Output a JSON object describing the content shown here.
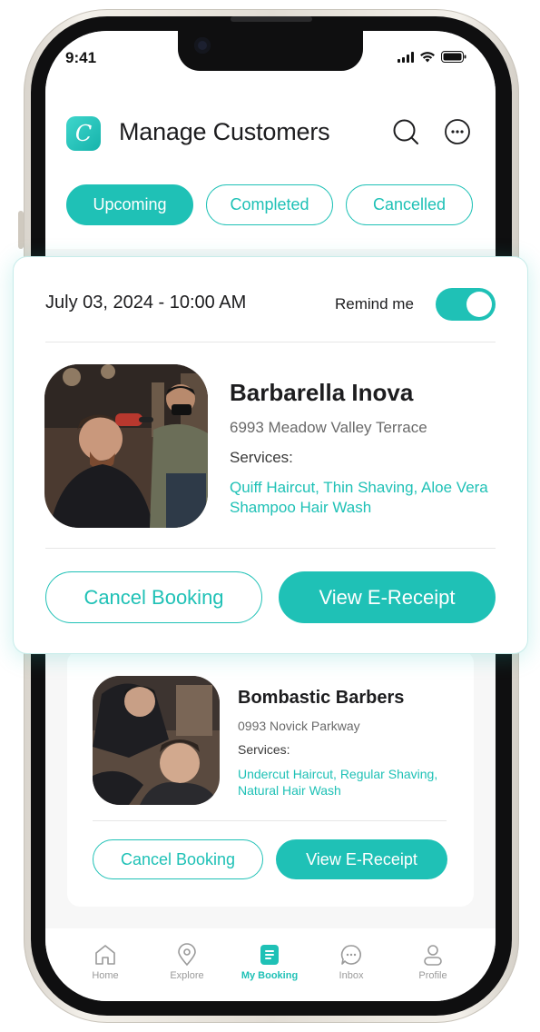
{
  "status": {
    "time": "9:41"
  },
  "header": {
    "title": "Manage Customers",
    "logo_letter": "C"
  },
  "tabs": [
    {
      "label": "Upcoming",
      "active": true
    },
    {
      "label": "Completed",
      "active": false
    },
    {
      "label": "Cancelled",
      "active": false
    }
  ],
  "booking_main": {
    "datetime": "July 03, 2024 - 10:00 AM",
    "remind_label": "Remind me",
    "remind_on": true,
    "shop_name": "Barbarella Inova",
    "address": "6993 Meadow Valley Terrace",
    "services_label": "Services:",
    "services": "Quiff Haircut, Thin Shaving, Aloe Vera Shampoo Hair Wash",
    "cancel_label": "Cancel Booking",
    "receipt_label": "View E-Receipt"
  },
  "booking_second": {
    "shop_name": "Bombastic Barbers",
    "address": "0993 Novick Parkway",
    "services_label": "Services:",
    "services": "Undercut Haircut, Regular Shaving, Natural Hair Wash",
    "cancel_label": "Cancel Booking",
    "receipt_label": "View E-Receipt"
  },
  "nav": [
    {
      "label": "Home",
      "icon": "home-icon"
    },
    {
      "label": "Explore",
      "icon": "location-pin-icon"
    },
    {
      "label": "My Booking",
      "icon": "booking-icon",
      "active": true
    },
    {
      "label": "Inbox",
      "icon": "chat-icon"
    },
    {
      "label": "Profile",
      "icon": "user-icon"
    }
  ],
  "colors": {
    "accent": "#1fc1b6",
    "text": "#1d1d1f",
    "muted": "#6a6a6a"
  }
}
